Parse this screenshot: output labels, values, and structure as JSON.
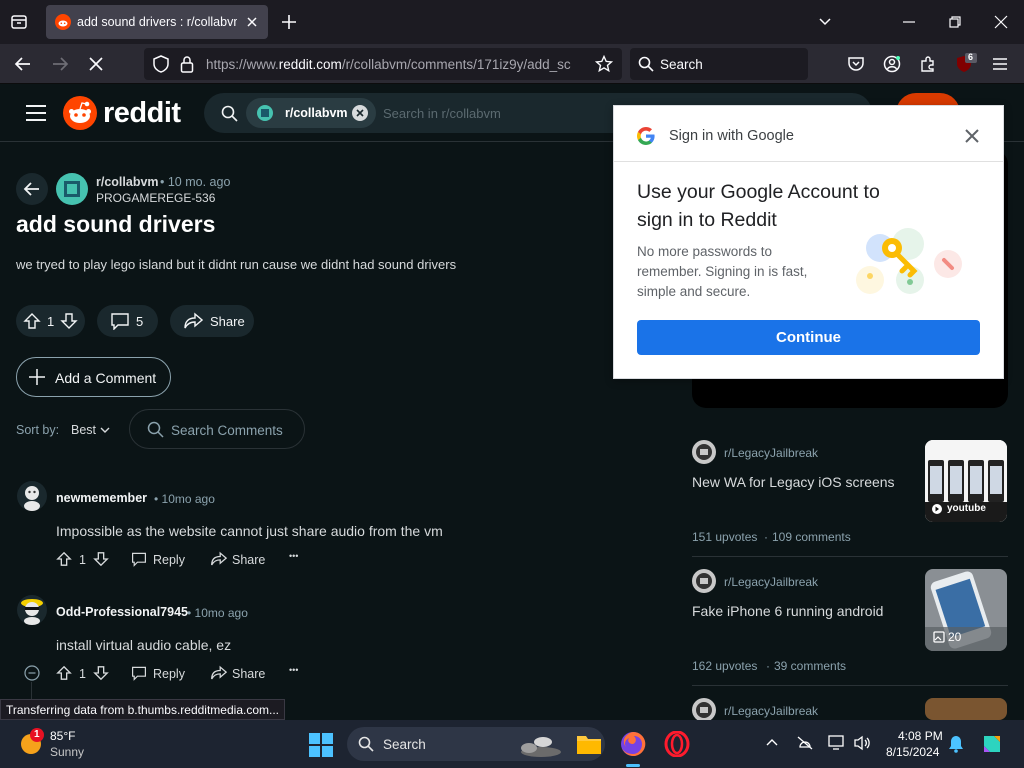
{
  "browser": {
    "tab_title": "add sound drivers : r/collabvm",
    "url_prefix": "https://www.",
    "url_domain": "reddit.com",
    "url_path": "/r/collabvm/comments/171iz9y/add_sc",
    "search_placeholder": "Search",
    "ext_badge": "6"
  },
  "reddit": {
    "logo_text": "reddit",
    "search_chip": "r/collabvm",
    "search_placeholder": "Search in r/collabvm"
  },
  "post": {
    "subreddit": "r/collabvm",
    "age": "• 10 mo. ago",
    "author": "PROGAMEREGE-536",
    "title": "add sound drivers",
    "body": "we tryed to play lego island but it didnt run cause we didnt had sound drivers",
    "votes": "1",
    "comments": "5",
    "share_label": "Share"
  },
  "comments_area": {
    "add_comment_label": "Add a Comment",
    "sort_label": "Sort by:",
    "sort_value": "Best",
    "search_placeholder": "Search Comments"
  },
  "comments": [
    {
      "author": "newmemember",
      "age": "• 10mo ago",
      "text": "Impossible as the website cannot just share audio from the vm",
      "votes": "1",
      "reply": "Reply",
      "share": "Share",
      "more": "•••"
    },
    {
      "author": "Odd-Professional7945",
      "age": "• 10mo ago",
      "text": "install virtual audio cable, ez",
      "votes": "1",
      "reply": "Reply",
      "share": "Share",
      "more": "•••"
    }
  ],
  "sidebar_feed": [
    {
      "subreddit": "r/LegacyJailbreak",
      "title": "New WA for Legacy iOS screens",
      "upvotes": "151 upvotes",
      "comments": "109 comments",
      "thumb_label": "youtube"
    },
    {
      "subreddit": "r/LegacyJailbreak",
      "title": "Fake iPhone 6 running android",
      "upvotes": "162 upvotes",
      "comments": "39 comments",
      "thumb_label": "20"
    },
    {
      "subreddit": "r/LegacyJailbreak"
    }
  ],
  "google_popup": {
    "header": "Sign in with Google",
    "title": "Use your Google Account to sign in to Reddit",
    "description": "No more passwords to remember. Signing in is fast, simple and secure.",
    "button": "Continue"
  },
  "status_text": "Transferring data from b.thumbs.redditmedia.com...",
  "taskbar": {
    "weather_temp": "85°F",
    "weather_desc": "Sunny",
    "weather_badge": "1",
    "search_label": "Search",
    "time": "4:08 PM",
    "date": "8/15/2024"
  },
  "colors": {
    "reddit_orange": "#ff4500",
    "google_blue": "#1a73e8",
    "page_bg": "#0b1416"
  }
}
